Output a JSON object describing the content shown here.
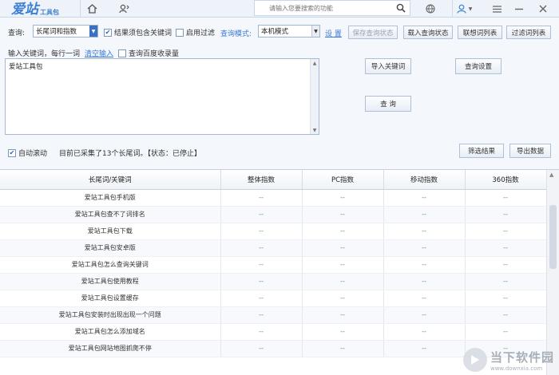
{
  "app": {
    "logo_big": "爱站",
    "logo_small": "工具包"
  },
  "titlebar": {
    "search_placeholder": "请输入您要搜索的功能"
  },
  "query_bar": {
    "label": "查询:",
    "type_select": "长尾词和指数",
    "chk_contains": "结果须包含关键词",
    "chk_contains_checked": true,
    "chk_filter": "启用过滤",
    "chk_filter_checked": false,
    "mode_label": "查询模式:",
    "mode_select": "本机模式",
    "settings_link": "设 置",
    "buttons": [
      "保存查询状态",
      "载入查询状态",
      "联想词列表",
      "过滤词列表"
    ]
  },
  "input_panel": {
    "hint": "输入关键词，每行一词",
    "clear_link": "清空输入",
    "chk_baidu": "查询百度收录量",
    "chk_baidu_checked": false,
    "textarea_value": "爱站工具包",
    "btn_import": "导入关键词",
    "btn_query_settings": "查询设置",
    "btn_query": "查 询"
  },
  "status_row": {
    "auto_scroll": "自动滚动",
    "auto_scroll_checked": true,
    "status": "目前已采集了13个长尾词。【状态：已停止】",
    "btn_filter": "筛选结果",
    "btn_export": "导出数据"
  },
  "table": {
    "columns": [
      "长尾词/关键词",
      "整体指数",
      "PC指数",
      "移动指数",
      "360指数"
    ],
    "rows": [
      [
        "爱站工具包手机版",
        "--",
        "--",
        "--",
        "--"
      ],
      [
        "爱站工具包查不了词排名",
        "--",
        "--",
        "--",
        "--"
      ],
      [
        "爱站工具包下载",
        "--",
        "--",
        "--",
        "--"
      ],
      [
        "爱站工具包安卓版",
        "--",
        "--",
        "--",
        "--"
      ],
      [
        "爱站工具包怎么查询关键词",
        "--",
        "--",
        "--",
        "--"
      ],
      [
        "爱站工具包使用教程",
        "--",
        "--",
        "--",
        "--"
      ],
      [
        "爱站工具包设置缓存",
        "--",
        "--",
        "--",
        "--"
      ],
      [
        "爱站工具包安装时出现出现一个问题",
        "--",
        "--",
        "--",
        "--"
      ],
      [
        "爱站工具包怎么添加域名",
        "--",
        "--",
        "--",
        "--"
      ],
      [
        "爱站工具包网站地图抓爬不停",
        "--",
        "--",
        "--",
        "--"
      ]
    ]
  },
  "watermark": {
    "line1": "当下软件园",
    "line2": "www.downxia.com"
  },
  "icons": {
    "home": "home-icon",
    "user_add": "user-icon",
    "search": "search-icon",
    "basketball": "ball-icon",
    "account": "account-icon",
    "menu": "menu-icon",
    "minimize": "minimize-icon",
    "close": "close-icon"
  },
  "colors": {
    "accent": "#3c7ad6",
    "logo": "#3d7fd1"
  }
}
